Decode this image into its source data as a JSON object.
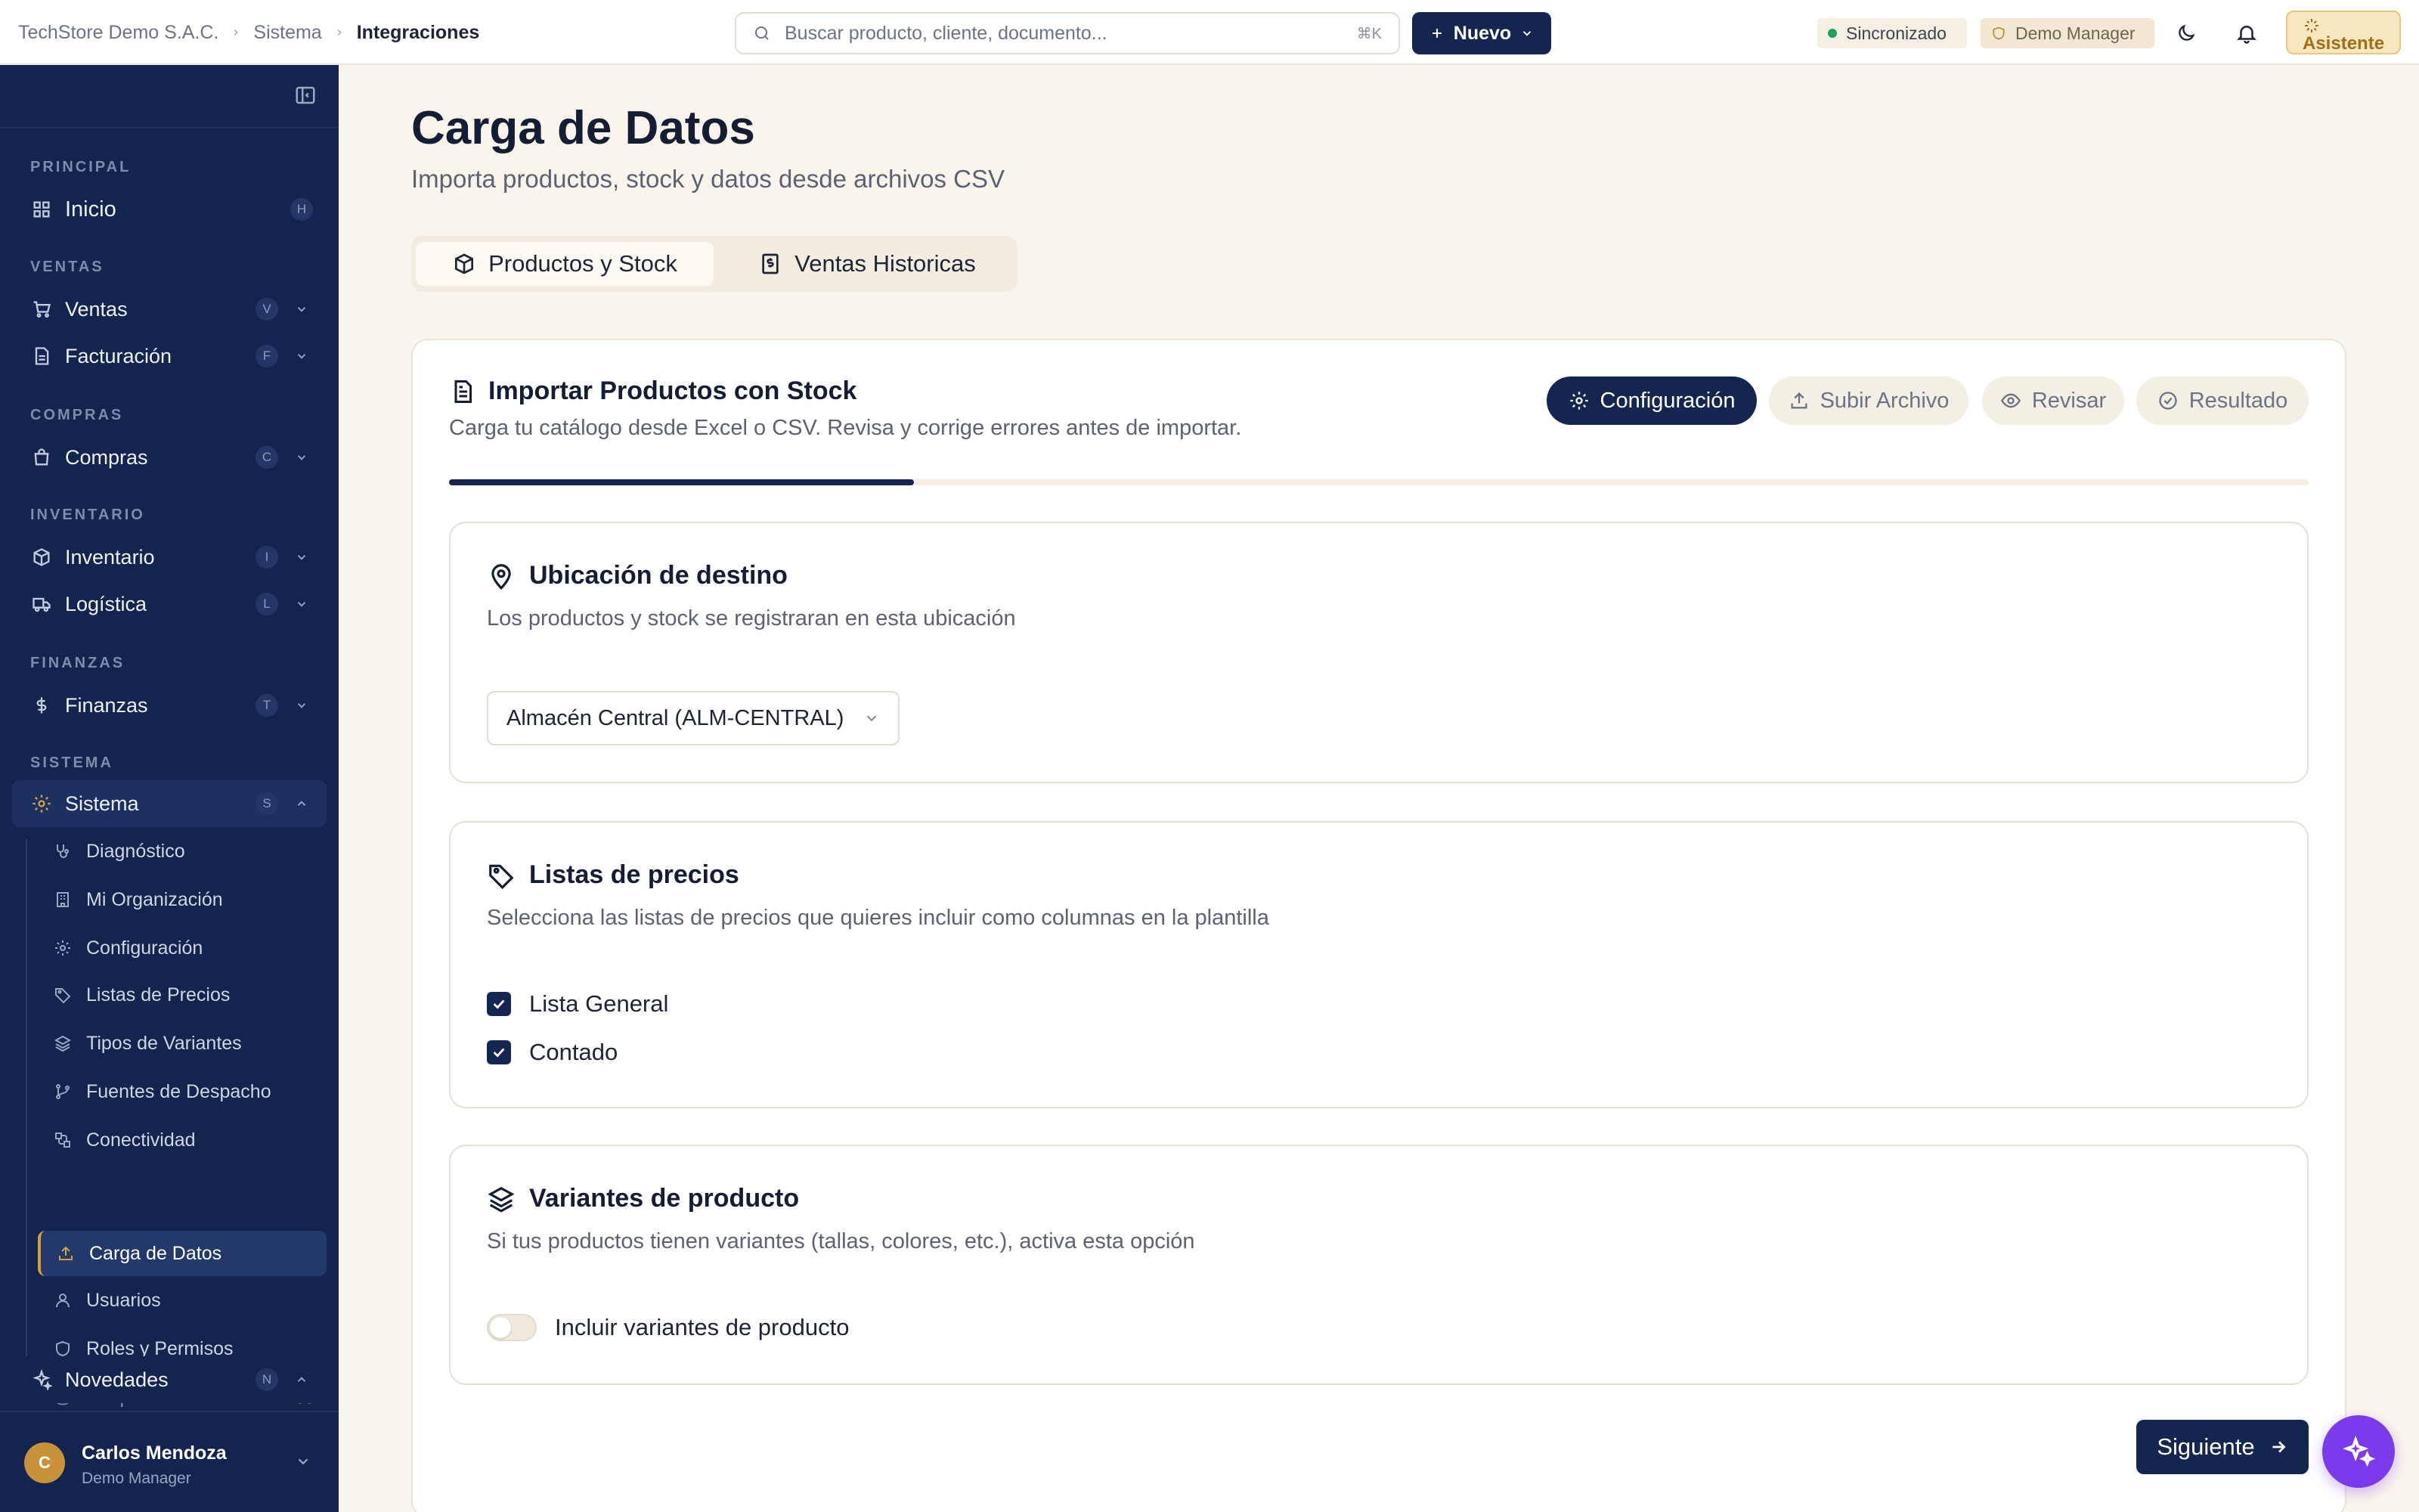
{
  "breadcrumb": {
    "org": "TechStore Demo S.A.C.",
    "section": "Sistema",
    "current": "Integraciones"
  },
  "search": {
    "placeholder": "Buscar producto, cliente, documento...",
    "shortcut": "⌘K"
  },
  "header": {
    "new_label": "Nuevo",
    "sync_label": "Sincronizado",
    "role_label": "Demo Manager",
    "assistant_label": "Asistente"
  },
  "sidebar": {
    "sections": {
      "principal": "PRINCIPAL",
      "ventas": "VENTAS",
      "compras": "COMPRAS",
      "inventario": "INVENTARIO",
      "finanzas": "FINANZAS",
      "sistema": "SISTEMA"
    },
    "items": {
      "inicio": {
        "label": "Inicio",
        "key": "H"
      },
      "ventas": {
        "label": "Ventas",
        "key": "V"
      },
      "facturacion": {
        "label": "Facturación",
        "key": "F"
      },
      "compras": {
        "label": "Compras",
        "key": "C"
      },
      "inventario": {
        "label": "Inventario",
        "key": "I"
      },
      "logistica": {
        "label": "Logística",
        "key": "L"
      },
      "finanzas": {
        "label": "Finanzas",
        "key": "T"
      },
      "sistema": {
        "label": "Sistema",
        "key": "S"
      },
      "novedades": {
        "label": "Novedades",
        "key": "N"
      }
    },
    "sub_items": {
      "diagnostico": "Diagnóstico",
      "organizacion": "Mi Organización",
      "configuracion": "Configuración",
      "listas": "Listas de Precios",
      "variantes": "Tipos de Variantes",
      "despacho": "Fuentes de Despacho",
      "conectividad": "Conectividad",
      "carga": "Carga de Datos",
      "usuarios": "Usuarios",
      "roles": "Roles y Permisos",
      "respaldos": "Respaldos"
    },
    "user": {
      "initial": "C",
      "name": "Carlos Mendoza",
      "role": "Demo Manager"
    }
  },
  "page": {
    "title": "Carga de Datos",
    "subtitle": "Importa productos, stock y datos desde archivos CSV",
    "tabs": {
      "products": "Productos y Stock",
      "sales": "Ventas Historicas"
    }
  },
  "card": {
    "title": "Importar Productos con Stock",
    "description": "Carga tu catálogo desde Excel o CSV. Revisa y corrige errores antes de importar.",
    "steps": {
      "config": "Configuración",
      "upload": "Subir Archivo",
      "review": "Revisar",
      "result": "Resultado"
    },
    "progress_fraction": 0.25,
    "location": {
      "title": "Ubicación de destino",
      "description": "Los productos y stock se registraran en esta ubicación",
      "selected": "Almacén Central (ALM-CENTRAL)"
    },
    "price_lists": {
      "title": "Listas de precios",
      "description": "Selecciona las listas de precios que quieres incluir como columnas en la plantilla",
      "options": {
        "general": "Lista General",
        "contado": "Contado"
      }
    },
    "variants": {
      "title": "Variantes de producto",
      "description": "Si tus productos tienen variantes (tallas, colores, etc.), activa esta opción",
      "toggle_label": "Incluir variantes de producto"
    },
    "next_label": "Siguiente"
  }
}
